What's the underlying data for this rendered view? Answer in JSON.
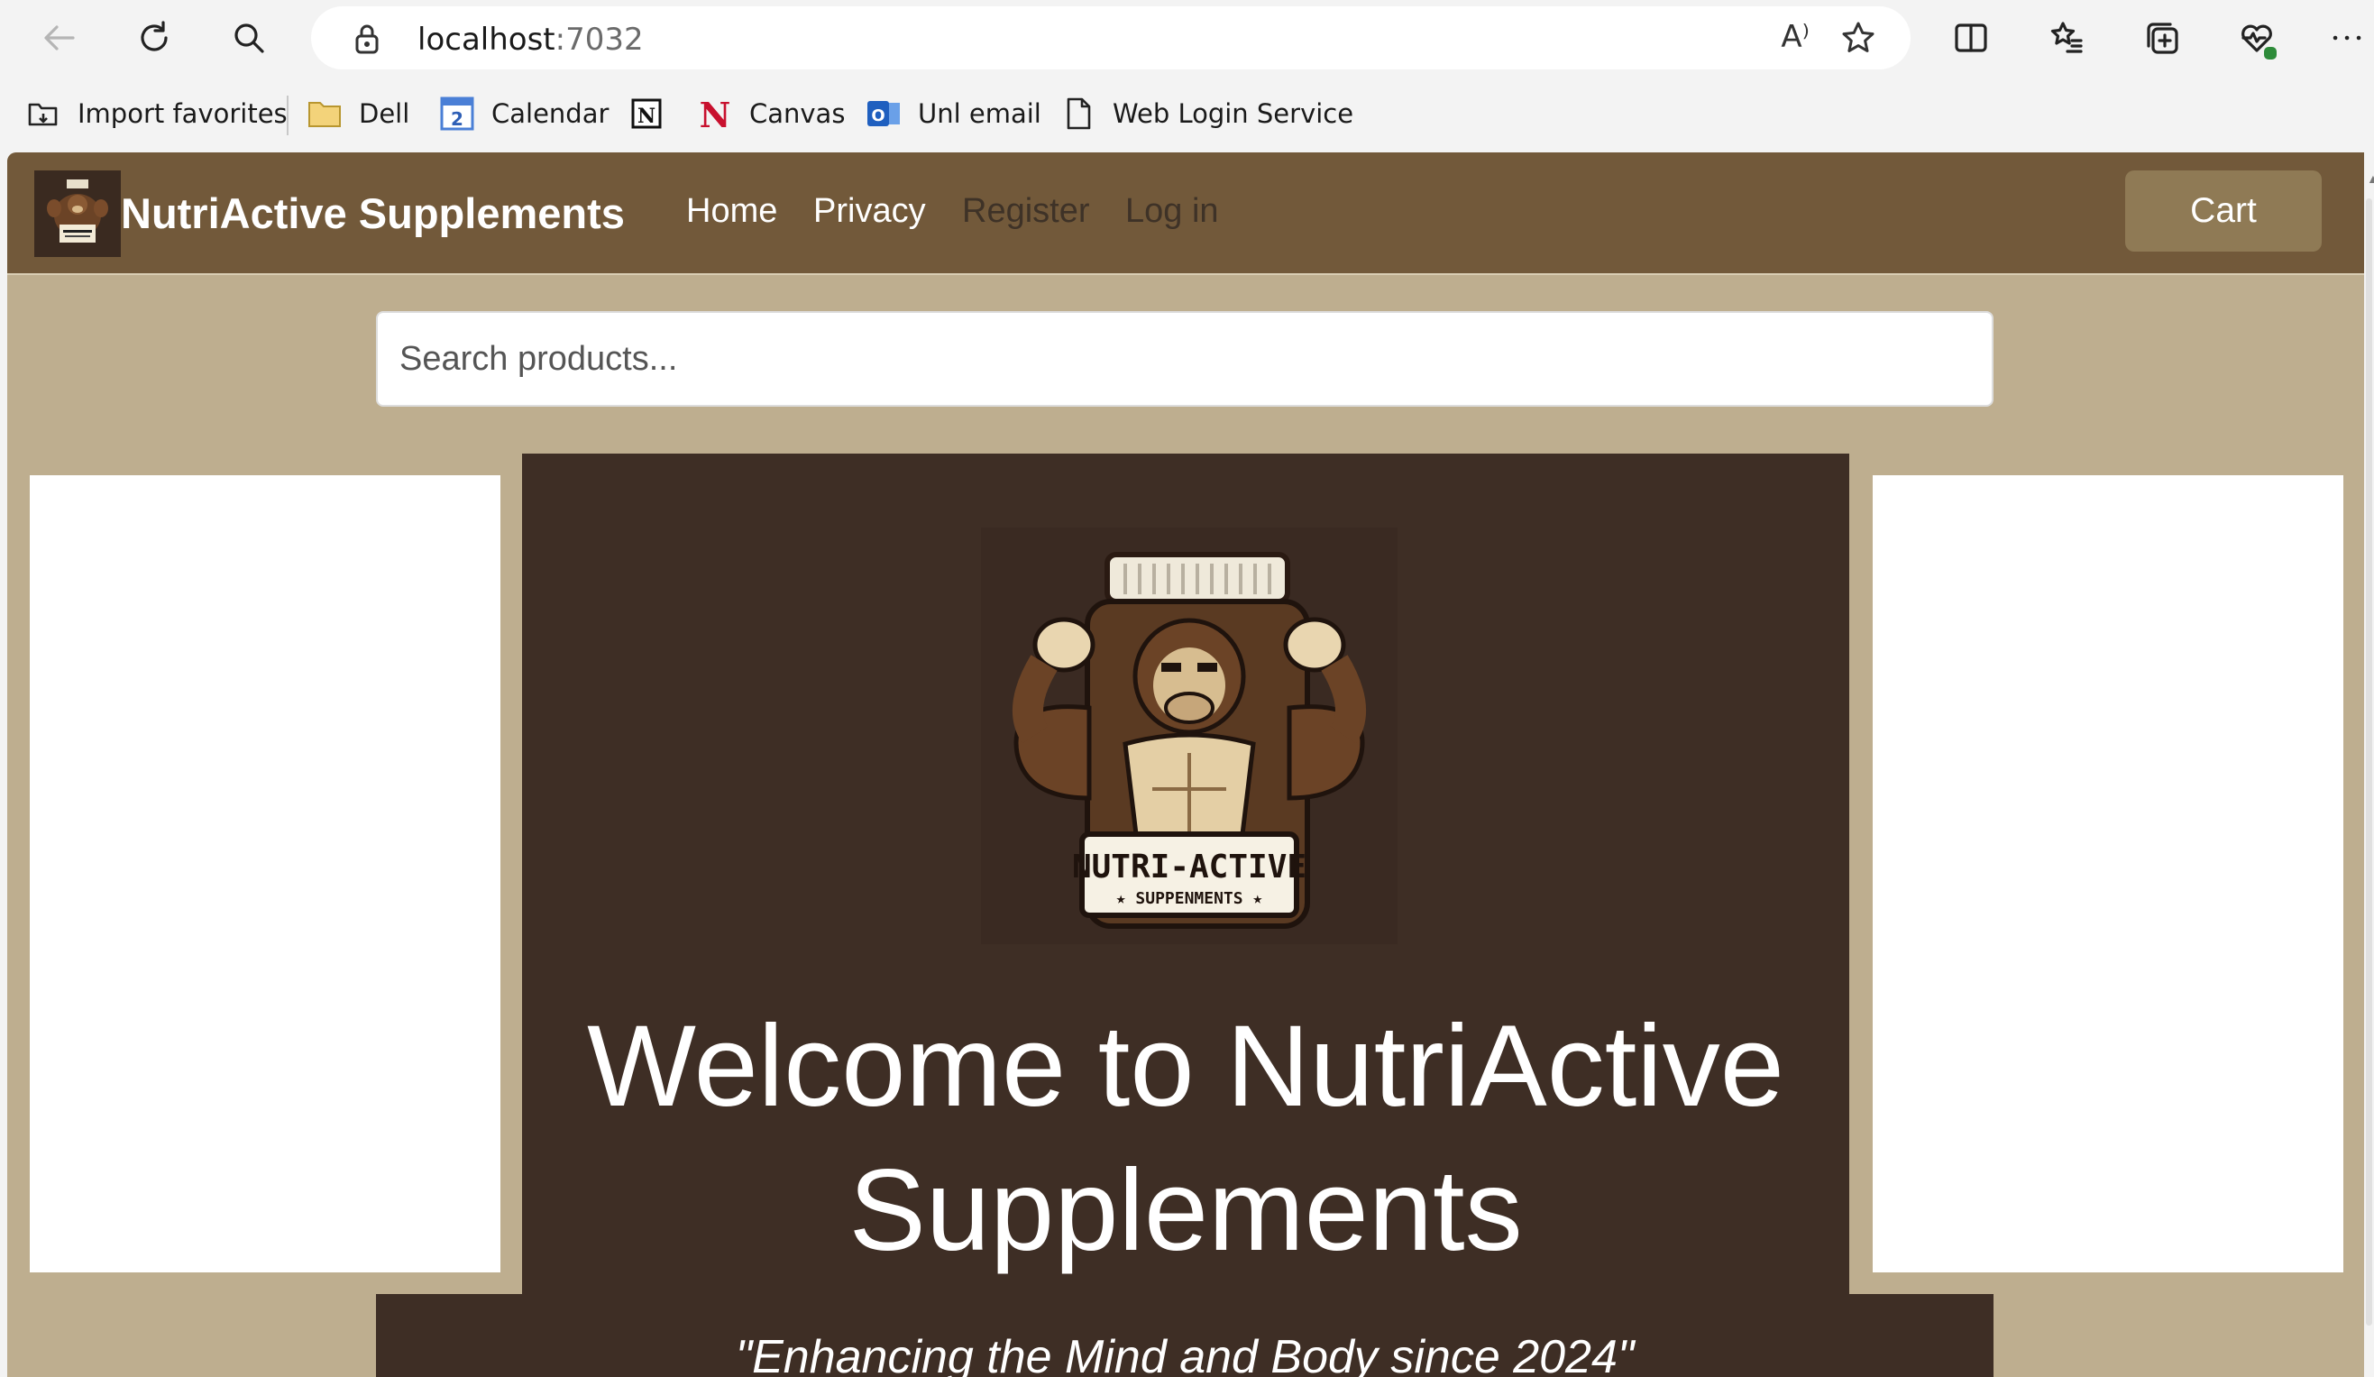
{
  "browser": {
    "url_host": "localhost",
    "url_port": ":7032",
    "read_aloud_label": "A⁾",
    "icons": {
      "back": "arrow-left-icon",
      "refresh": "refresh-icon",
      "search": "search-icon",
      "lock": "lock-icon",
      "favorite": "star-icon",
      "split": "split-screen-icon",
      "favorites": "favorites-list-icon",
      "collections": "collections-icon",
      "health": "heart-pulse-icon",
      "menu": "more-icon"
    }
  },
  "favorites_bar": [
    {
      "label": "Import favorites",
      "icon": "import-icon"
    },
    {
      "label": "Dell",
      "icon": "folder-icon"
    },
    {
      "label": "Calendar",
      "icon": "calendar-icon"
    },
    {
      "label": "",
      "icon": "notion-icon"
    },
    {
      "label": "Canvas",
      "icon": "canvas-icon"
    },
    {
      "label": "Unl email",
      "icon": "outlook-icon"
    },
    {
      "label": "Web Login Service",
      "icon": "page-icon"
    }
  ],
  "site": {
    "brand": "NutriActive Supplements",
    "nav": {
      "home": "Home",
      "privacy": "Privacy",
      "register": "Register",
      "login": "Log in"
    },
    "cart": "Cart",
    "search_placeholder": "Search products...",
    "hero_title": "Welcome to NutriActive Supplements",
    "tagline": "\"Enhancing the Mind and Body since 2024\"",
    "logo_text": {
      "main": "NUTRI-ACTIVE",
      "sub": "★ SUPPENMENTS ★"
    }
  },
  "colors": {
    "navbar": "#72593a",
    "page_bg": "#beae8f",
    "hero_bg": "#3e2e25",
    "cart_btn": "#8f7a55"
  }
}
